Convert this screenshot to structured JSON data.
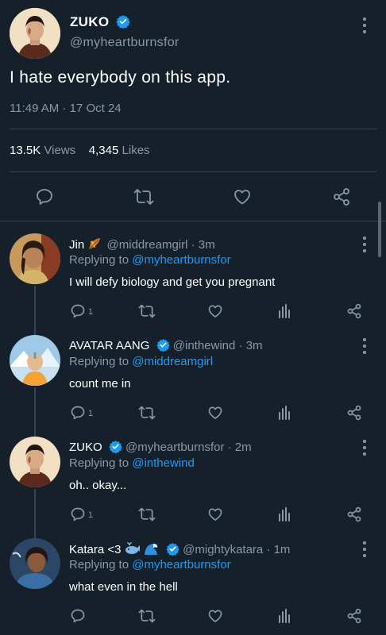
{
  "main_tweet": {
    "author_name": "ZUKO",
    "author_handle": "@myheartburnsfor",
    "text": "I hate everybody on this app.",
    "timestamp": "11:49 AM · 17 Oct 24",
    "views_count": "13.5K",
    "views_label": "Views",
    "likes_count": "4,345",
    "likes_label": "Likes"
  },
  "replies": [
    {
      "name": "Jin",
      "handle_time": "@middreamgirl · 3m",
      "replying_prefix": "Replying to",
      "replying_to": "@myheartburnsfor",
      "text": "I will defy biology and get you pregnant",
      "reply_count": "1",
      "verified": false,
      "emoji": "leaf"
    },
    {
      "name": "AVATAR AANG",
      "handle_time": "@inthewind · 3m",
      "replying_prefix": "Replying to",
      "replying_to": "@middreamgirl",
      "text": "count me in",
      "reply_count": "1",
      "verified": true
    },
    {
      "name": "ZUKO",
      "handle_time": "@myheartburnsfor · 2m",
      "replying_prefix": "Replying to",
      "replying_to": "@inthewind",
      "text": "oh.. okay...",
      "reply_count": "1",
      "verified": true
    },
    {
      "name": "Katara <3",
      "handle_time": "@mightykatara · 1m",
      "replying_prefix": "Replying to",
      "replying_to": "@myheartburnsfor",
      "text": "what even in the hell",
      "reply_count": "",
      "verified": true,
      "emoji": "whale-wave"
    }
  ],
  "colors": {
    "background": "#15202b",
    "accent": "#1d9bf0",
    "muted": "#8899a6",
    "divider": "#38444d"
  },
  "icons": [
    "reply-icon",
    "retweet-icon",
    "like-icon",
    "analytics-icon",
    "share-icon",
    "more-options-icon",
    "verified-badge-icon"
  ]
}
